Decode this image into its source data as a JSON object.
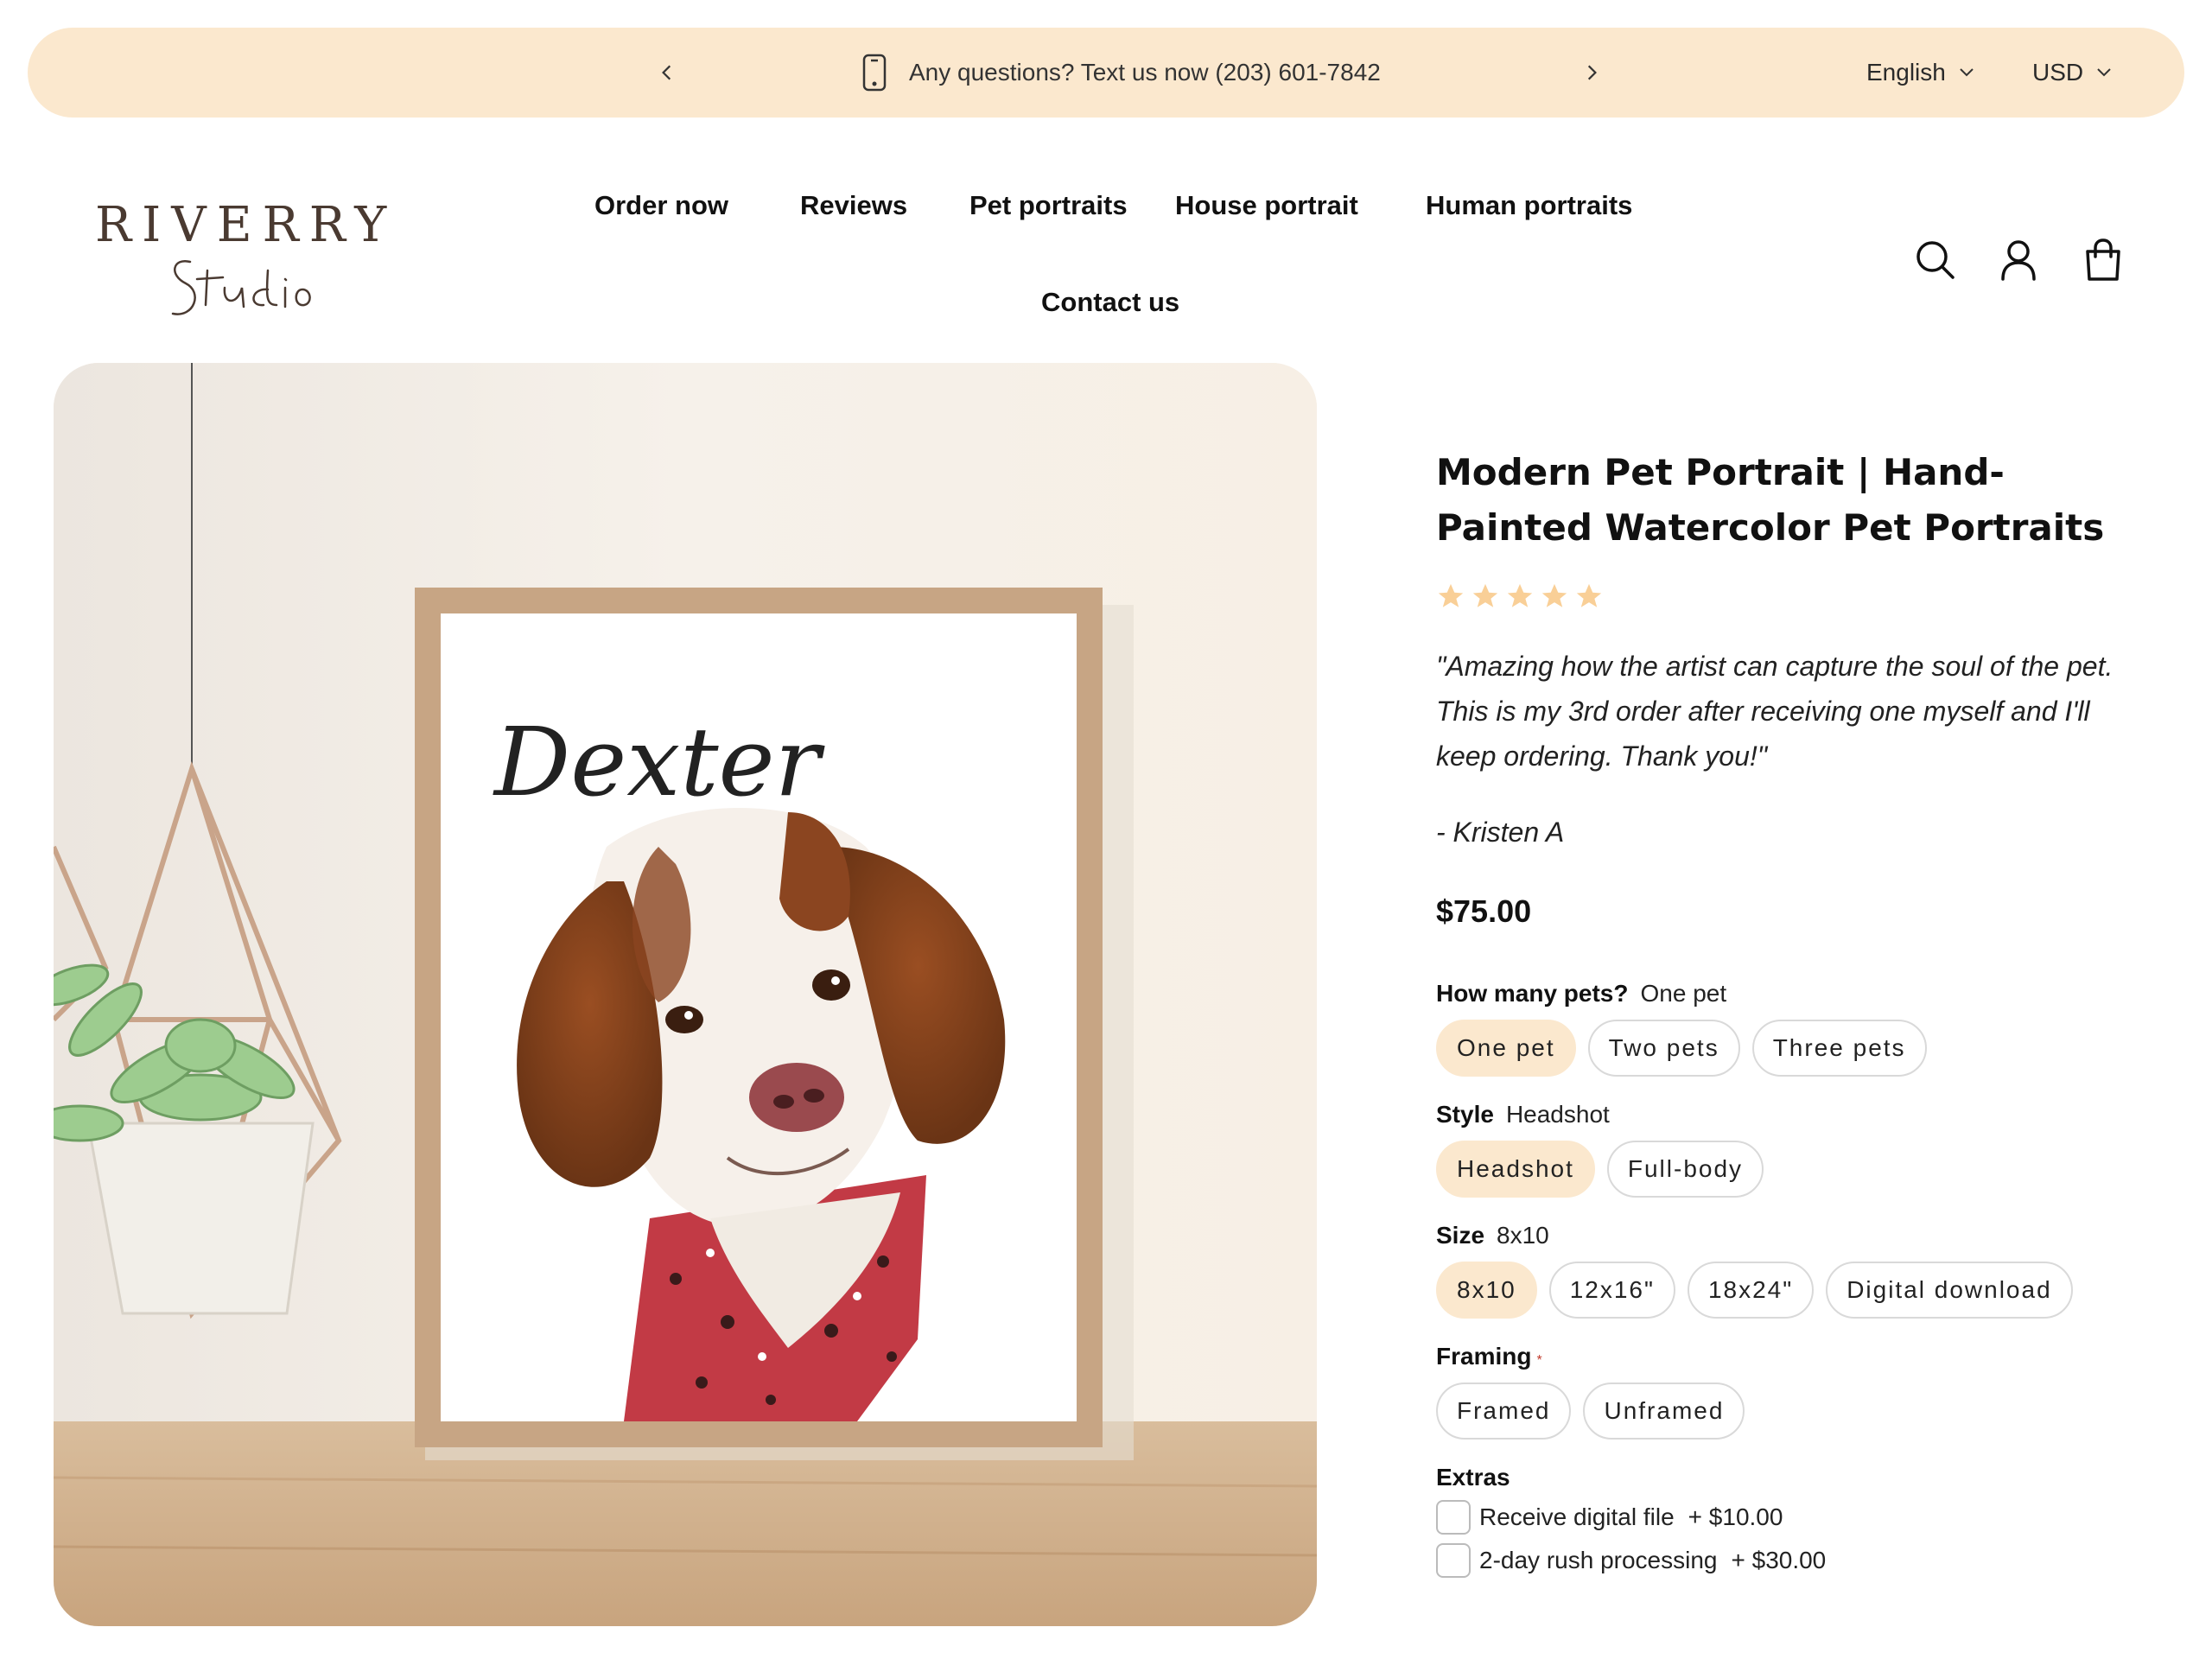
{
  "announcement": {
    "message": "Any questions? Text us now (203) 601-7842",
    "language": "English",
    "currency": "USD"
  },
  "logo": {
    "wordmark": "RIVERRY",
    "script": "Studio"
  },
  "nav": {
    "items": [
      "Order now",
      "Reviews",
      "Pet portraits",
      "House portrait",
      "Human portraits",
      "Contact us"
    ]
  },
  "product": {
    "title": "Modern Pet Portrait | Hand-Painted Watercolor Pet Portraits",
    "rating": 5,
    "quote": "\"Amazing how the artist can capture the soul of the pet. This is my 3rd order after receiving one myself and I'll keep ordering. Thank you!\"",
    "author": "- Kristen A",
    "price": "$75.00",
    "image_name_text": "Dexter",
    "options": {
      "pets": {
        "label": "How many pets?",
        "selected": "One pet",
        "choices": [
          "One pet",
          "Two pets",
          "Three pets"
        ]
      },
      "style": {
        "label": "Style",
        "selected": "Headshot",
        "choices": [
          "Headshot",
          "Full-body"
        ]
      },
      "size": {
        "label": "Size",
        "selected": "8x10",
        "choices": [
          "8x10",
          "12x16\"",
          "18x24\"",
          "Digital download"
        ]
      },
      "framing": {
        "label": "Framing",
        "required_mark": "*",
        "choices": [
          "Framed",
          "Unframed"
        ]
      },
      "extras": {
        "label": "Extras",
        "items": [
          {
            "label": "Receive digital file",
            "price": "+ $10.00"
          },
          {
            "label": "2-day rush processing",
            "price": "+ $30.00"
          }
        ]
      }
    }
  },
  "colors": {
    "accent": "#fbe8ce",
    "star": "#f9cf97",
    "text": "#111111"
  }
}
